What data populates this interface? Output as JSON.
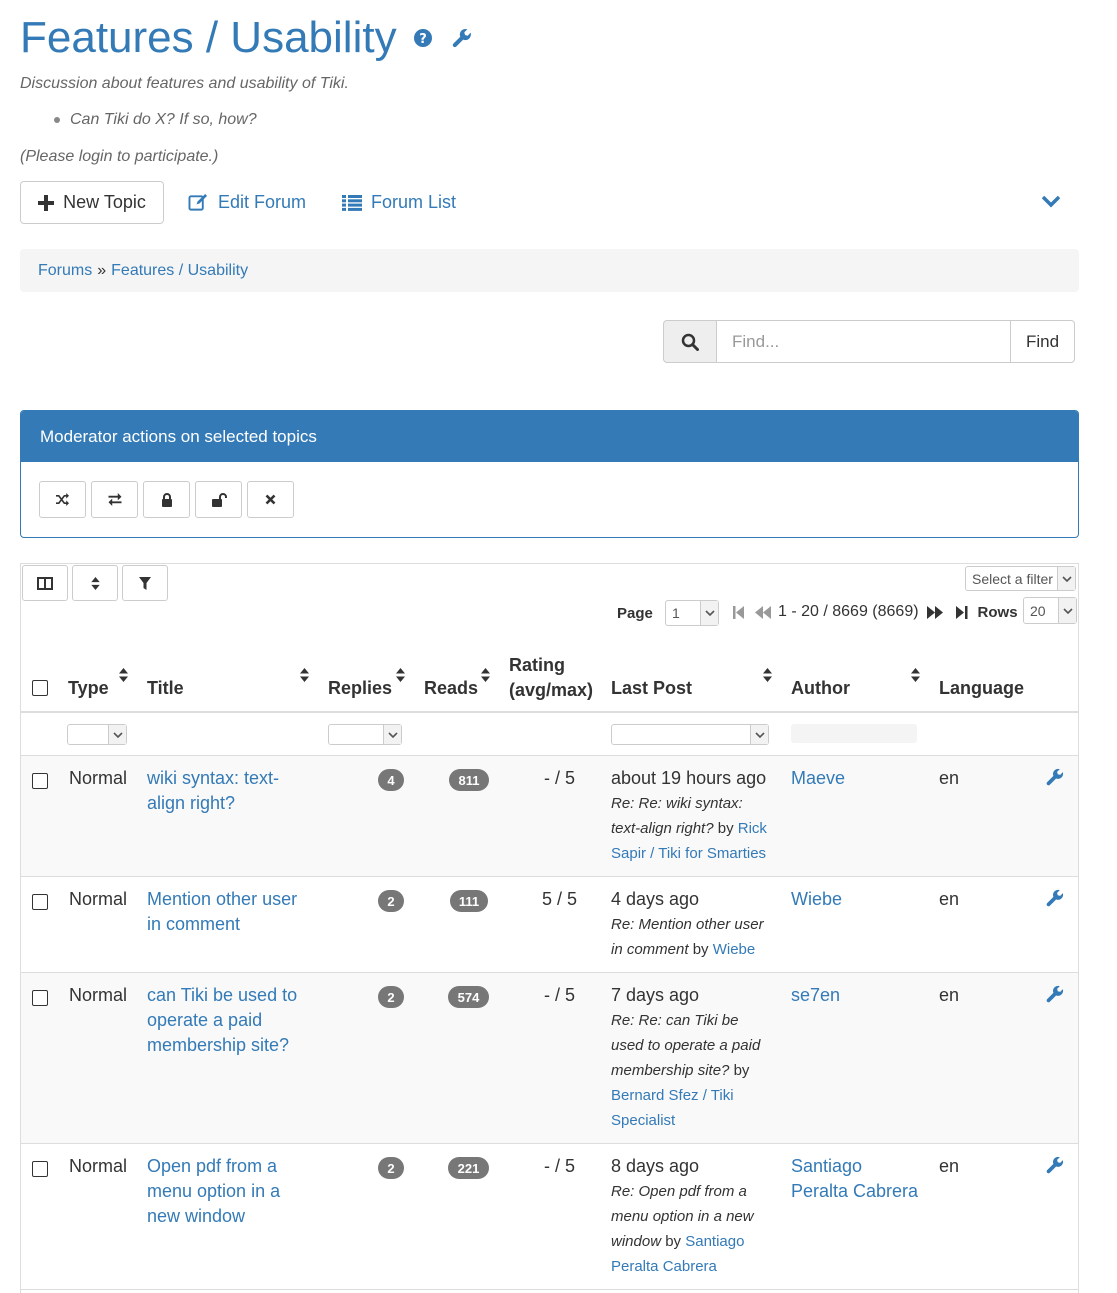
{
  "header": {
    "title": "Features / Usability",
    "description": "Discussion about features and usability of Tiki.",
    "bullets": [
      "Can Tiki do X? If so, how?"
    ],
    "login_note": "(Please login to participate.)"
  },
  "toolbar": {
    "new_topic": "New Topic",
    "edit_forum": "Edit Forum",
    "forum_list": "Forum List"
  },
  "breadcrumb": {
    "root": "Forums",
    "separator": "»",
    "current": "Features / Usability"
  },
  "search": {
    "placeholder": "Find...",
    "button": "Find"
  },
  "moderator": {
    "title": "Moderator actions on selected topics",
    "actions": [
      "shuffle-icon",
      "exchange-icon",
      "lock-icon",
      "unlock-icon",
      "close-icon"
    ]
  },
  "table_controls": {
    "filter_select": "Select a filter",
    "page_label": "Page",
    "page_value": "1",
    "range": "1 - 20 / 8669 (8669)",
    "rows_label": "Rows",
    "rows_value": "20"
  },
  "columns": {
    "type": "Type",
    "title": "Title",
    "replies": "Replies",
    "reads": "Reads",
    "rating_line1": "Rating",
    "rating_line2": "(avg/max)",
    "last_post": "Last Post",
    "author": "Author",
    "language": "Language"
  },
  "topics": [
    {
      "type": "Normal",
      "title_lines": [
        "wiki syntax: text-",
        "align right?"
      ],
      "replies": "4",
      "reads": "811",
      "rating": "- / 5",
      "last_post_time": "about 19 hours ago",
      "last_post_lines": [
        "Re: Re: wiki syntax:",
        "text-align right?"
      ],
      "last_post_by_lines": [
        "Rick",
        "Sapir / Tiki for Smarties"
      ],
      "author_lines": [
        "Maeve"
      ],
      "language": "en"
    },
    {
      "type": "Normal",
      "title_lines": [
        "Mention other user",
        "in comment"
      ],
      "replies": "2",
      "reads": "111",
      "rating": "5 / 5",
      "last_post_time": "4 days ago",
      "last_post_lines": [
        "Re: Mention other user",
        "in comment"
      ],
      "last_post_by_lines": [
        "Wiebe"
      ],
      "author_lines": [
        "Wiebe"
      ],
      "language": "en"
    },
    {
      "type": "Normal",
      "title_lines": [
        "can Tiki be used to",
        "operate a paid",
        "membership site?"
      ],
      "replies": "2",
      "reads": "574",
      "rating": "- / 5",
      "last_post_time": "7 days ago",
      "last_post_lines": [
        "Re: Re: can Tiki be",
        "used to operate a paid",
        "membership site?"
      ],
      "last_post_by_lines": [
        "Bernard Sfez / Tiki",
        "Specialist"
      ],
      "author_lines": [
        "se7en"
      ],
      "language": "en"
    },
    {
      "type": "Normal",
      "title_lines": [
        "Open pdf from a",
        "menu option in a",
        "new window"
      ],
      "replies": "2",
      "reads": "221",
      "rating": "- / 5",
      "last_post_time": "8 days ago",
      "last_post_lines": [
        "Re: Open pdf from a",
        "menu option in a new"
      ],
      "last_post_window": "window",
      "last_post_by_lines": [
        "Santiago",
        "Peralta Cabrera"
      ],
      "author_lines": [
        "Santiago",
        "Peralta Cabrera"
      ],
      "language": "en"
    }
  ],
  "by_word": "by",
  "colors": {
    "primary": "#337ab7",
    "badge": "#777777",
    "breadcrumb_bg": "#f5f5f5",
    "row_alt": "#f9f9f9"
  }
}
